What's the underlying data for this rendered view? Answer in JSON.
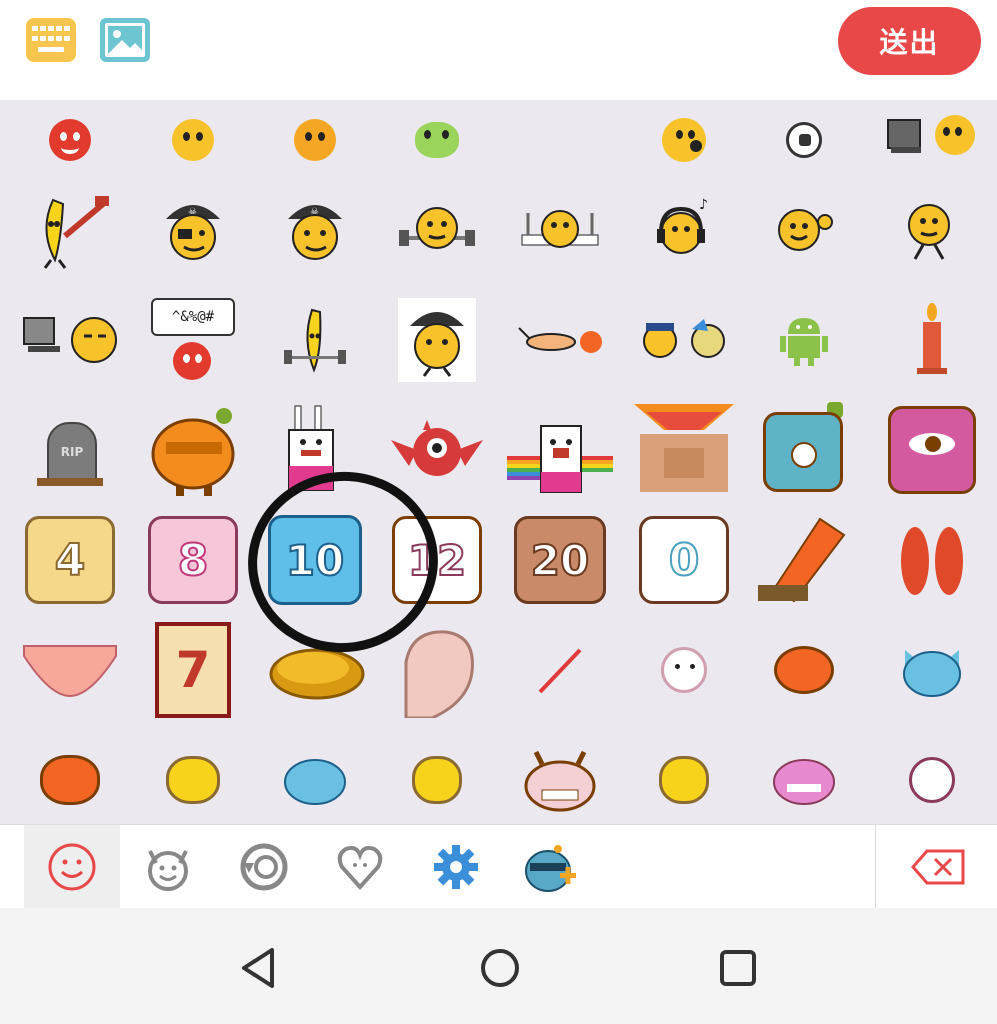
{
  "header": {
    "send_label": "送出",
    "icons": [
      "keyboard-icon",
      "image-icon"
    ]
  },
  "emoji_grid": {
    "tiles": {
      "yellow_4": "4",
      "pink_8": "8",
      "blue_10": "10",
      "white_12": "12",
      "brown_20": "20",
      "white_0": "0",
      "slot_7": "7",
      "tombstone": "RIP",
      "pictograph_speech": "^&%@#"
    },
    "colors": {
      "grid_bg": "#ebe8ef",
      "send": "#e94848",
      "active_tab": "#e94848",
      "settings": "#3a8fd8"
    }
  },
  "toolbar": {
    "tabs": [
      "smiley-tab-icon",
      "devil-tab-icon",
      "recent-tab-icon",
      "heart-tab-icon",
      "settings-tab-icon",
      "add-sticker-tab-icon"
    ],
    "active": "smiley-tab-icon",
    "backspace": "backspace-icon"
  },
  "navbar": {
    "buttons": [
      "back-icon",
      "home-icon",
      "recents-icon"
    ]
  }
}
